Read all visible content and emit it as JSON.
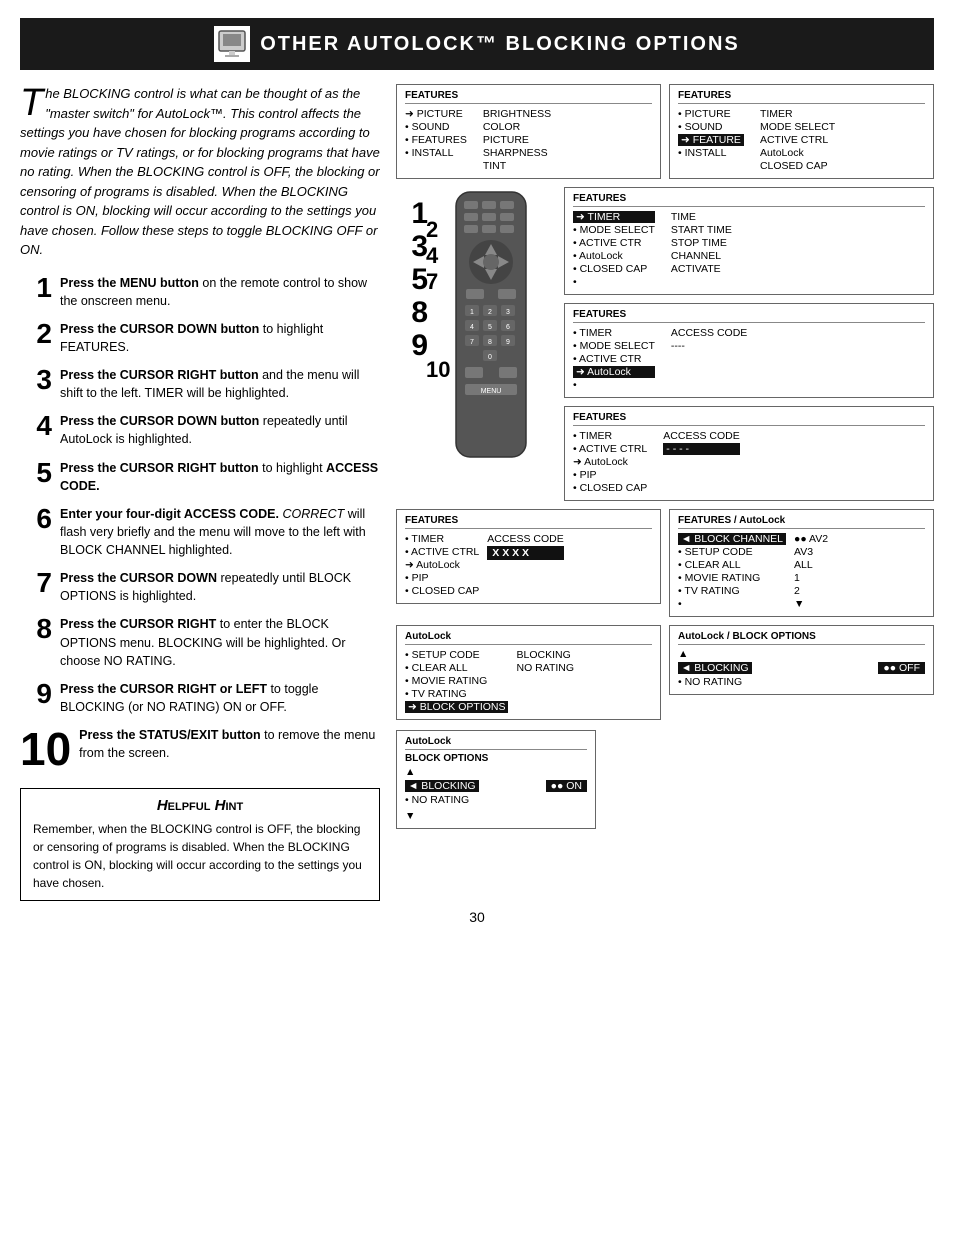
{
  "header": {
    "title": "Other AutoLock™ Blocking Options"
  },
  "intro": {
    "text": "he BLOCKING control is what can be thought of as the \"master switch\" for AutoLock™. This control affects the settings you have chosen for blocking programs according to movie ratings or TV ratings, or for blocking programs that have no rating. When the BLOCKING control is OFF, the blocking or censoring of programs is disabled. When the BLOCKING control is ON, blocking will occur according to the settings you have chosen. Follow these steps to toggle BLOCKING OFF or ON."
  },
  "steps": [
    {
      "num": "1",
      "text": "Press the MENU button on the remote control to show the onscreen menu."
    },
    {
      "num": "2",
      "text": "Press the CURSOR DOWN button to highlight FEATURES."
    },
    {
      "num": "3",
      "text": "Press the CURSOR RIGHT button and the menu will shift to the left. TIMER will be highlighted."
    },
    {
      "num": "4",
      "text": "Press the CURSOR DOWN button repeatedly until AutoLock is highlighted."
    },
    {
      "num": "5",
      "text": "Press the CURSOR RIGHT button to highlight ACCESS CODE."
    },
    {
      "num": "6",
      "text": "Enter your four-digit ACCESS CODE. CORRECT will flash very briefly and the menu will move to the left with BLOCK CHANNEL highlighted."
    },
    {
      "num": "7",
      "text": "Press the CURSOR DOWN repeatedly until BLOCK OPTIONS is highlighted."
    },
    {
      "num": "8",
      "text": "Press the CURSOR RIGHT to enter the BLOCK OPTIONS menu. BLOCKING will be highlighted. Or choose NO RATING."
    },
    {
      "num": "9",
      "text": "Press the CURSOR RIGHT or LEFT to toggle BLOCKING (or NO RATING) ON or OFF."
    },
    {
      "num": "10",
      "text": "Press the STATUS/EXIT button to remove the menu from the screen."
    }
  ],
  "hint": {
    "title": "Helpful Hint",
    "text": "Remember, when the BLOCKING control is OFF, the blocking or censoring of programs is disabled. When the BLOCKING control is ON, blocking will occur according to the settings you have chosen."
  },
  "panels": {
    "panel1": {
      "title": "FEATURES",
      "left": [
        "• PICTURE",
        "• SOUND",
        "FEATURE",
        "• INSTALL"
      ],
      "left_hl": 2,
      "right": [
        "TIMER",
        "MODE SELECT",
        "ACTIVE CTRL",
        "AutoLock",
        "CLOSED CAP"
      ]
    },
    "panel2": {
      "title": "FEATURES",
      "left": [
        "TIMER",
        "• MODE SELECT",
        "• ACTIVE CTR",
        "• AutoLock",
        "• CLOSED CAP"
      ],
      "left_hl": 0,
      "right": [
        "TIME",
        "START TIME",
        "STOP TIME",
        "CHANNEL",
        "ACTIVATE"
      ]
    },
    "panel3": {
      "title": "FEATURES",
      "left": [
        "• TIMER",
        "• MODE SELECT",
        "• ACTIVE CTR",
        "AutoLock",
        "•"
      ],
      "left_hl": 3,
      "right": [
        "ACCESS CODE",
        "----"
      ]
    },
    "panel4": {
      "title": "FEATURES",
      "left": [
        "• TIMER",
        "• ACTIVE CTRL",
        "AutoLock",
        "• PIP",
        "• CLOSED CAP"
      ],
      "left_hl": 2,
      "right": [
        "ACCESS CODE",
        "- - - -"
      ]
    },
    "panel5": {
      "title": "FEATURES",
      "left": [
        "• TIMER",
        "• ACTIVE CTRL",
        "AutoLock",
        "• PIP",
        "• CLOSED CAP"
      ],
      "right_label": "ACCESS CODE",
      "right_val": "X X X X"
    },
    "panel6": {
      "title": "FEATURES / AutoLock",
      "items": [
        "BLOCK CHANNEL",
        "• SETUP CODE",
        "• CLEAR ALL",
        "• MOVIE RATING",
        "• TV RATING",
        "•"
      ],
      "hl": 0,
      "right": [
        "AV2",
        "AV3",
        "ALL",
        "1",
        "2",
        "▼"
      ]
    },
    "panel7": {
      "title": "AutoLock / BLOCK OPTIONS",
      "items": [
        "• BLOCKING",
        "• NO RATING"
      ],
      "hl": 0,
      "right": [
        "OFF",
        ""
      ]
    },
    "panel8": {
      "title": "AutoLock / BLOCK OPTIONS",
      "items": [
        "BLOCKING",
        "• NO RATING"
      ],
      "hl": 0,
      "right": [
        "ON",
        ""
      ]
    },
    "panel9": {
      "title": "AutoLock",
      "items": [
        "• SETUP CODE",
        "• CLEAR ALL",
        "• MOVIE RATING",
        "• TV RATING",
        "BLOCK OPTIONS"
      ],
      "hl": 4,
      "right": [
        "BLOCKING",
        "NO RATING"
      ]
    }
  },
  "page_number": "30",
  "screen1": {
    "left": [
      "➜ PICTURE",
      "• SOUND",
      "• FEATURES",
      "• INSTALL"
    ],
    "right": [
      "BRIGHTNESS",
      "COLOR",
      "PICTURE",
      "SHARPNESS",
      "TINT"
    ]
  }
}
